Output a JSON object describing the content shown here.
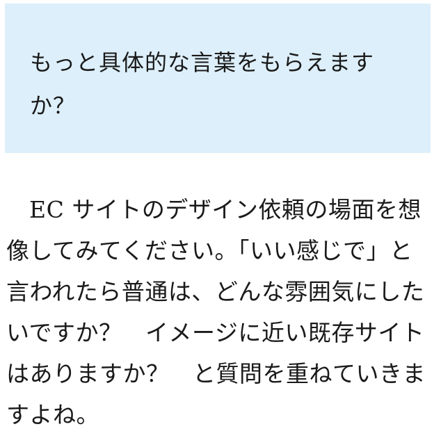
{
  "callout": {
    "question": "もっと具体的な言葉をもらえますか？"
  },
  "body": {
    "paragraph": "EC サイトのデザイン依頼の場面を想像してみてください。「いい感じで」と言われたら普通は、どんな雰囲気にしたいですか？　イメージに近い既存サイトはありますか？　と質問を重ねていきますよね。"
  }
}
